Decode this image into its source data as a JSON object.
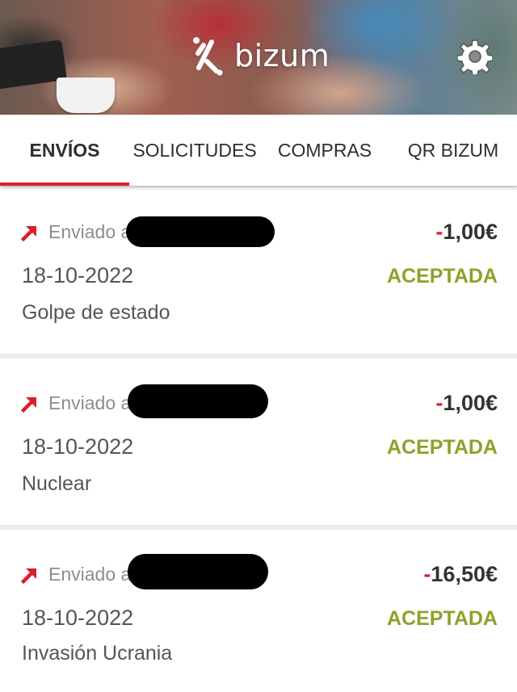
{
  "header": {
    "app_name": "bizum",
    "logo_icon": "bizum-logo-icon",
    "settings_icon": "gear-icon"
  },
  "tabs": [
    {
      "label": "ENVÍOS",
      "active": true
    },
    {
      "label": "SOLICITUDES",
      "active": false
    },
    {
      "label": "COMPRAS",
      "active": false
    },
    {
      "label": "QR BIZUM",
      "active": false
    }
  ],
  "colors": {
    "brand_red": "#d8202d",
    "status_green": "#8ba32a"
  },
  "transactions": [
    {
      "direction_icon": "arrow-up-right-icon",
      "label": "Enviado a",
      "recipient_redacted": true,
      "amount_sign": "-",
      "amount": "1,00€",
      "date": "18-10-2022",
      "status": "ACEPTADA",
      "concept": "Golpe de estado"
    },
    {
      "direction_icon": "arrow-up-right-icon",
      "label": "Enviado a",
      "recipient_redacted": true,
      "amount_sign": "-",
      "amount": "1,00€",
      "date": "18-10-2022",
      "status": "ACEPTADA",
      "concept": "Nuclear"
    },
    {
      "direction_icon": "arrow-up-right-icon",
      "label": "Enviado a",
      "recipient_redacted": true,
      "amount_sign": "-",
      "amount": "16,50€",
      "date": "18-10-2022",
      "status": "ACEPTADA",
      "concept": "Invasión Ucrania"
    }
  ]
}
